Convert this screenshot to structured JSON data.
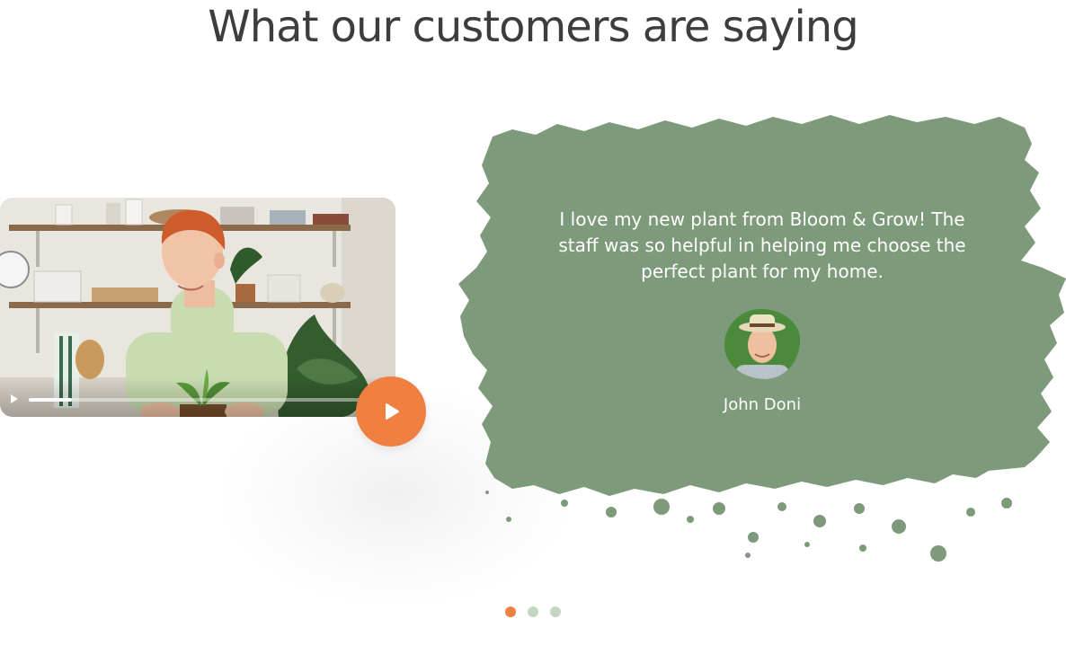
{
  "section": {
    "heading": "What our customers are saying"
  },
  "video": {
    "play_icon": "play-icon",
    "progress": 0.13
  },
  "testimonial": {
    "quote": "I love my new plant from Bloom & Grow! The staff was so helpful in helping me choose the perfect plant for my home.",
    "author": "John Doni"
  },
  "carousel": {
    "count": 3,
    "active_index": 0
  },
  "colors": {
    "accent": "#f07f42",
    "card": "#7d9b7a",
    "dot_inactive": "#c3d7c0",
    "heading": "#3d3d3d"
  }
}
